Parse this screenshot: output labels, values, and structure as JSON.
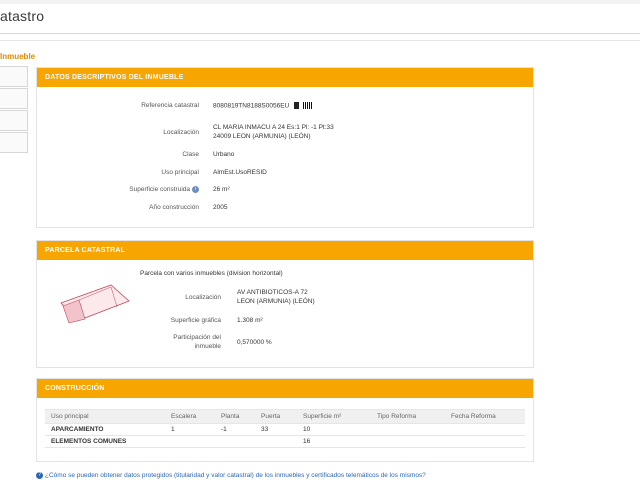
{
  "header": {
    "title": "atastro"
  },
  "section_label": "Inmueble",
  "datos": {
    "heading": "DATOS DESCRIPTIVOS DEL INMUEBLE",
    "ref_label": "Referencia catastral",
    "ref_value": "8080819TN8188S0056EU",
    "loc_label": "Localización",
    "loc_line1": "CL MARIA INMACU A 24 Es:1 Pl: -1 Pt:33",
    "loc_line2": "24009 LEON (ARMUNIA) (LEÓN)",
    "clase_label": "Clase",
    "clase_value": "Urbano",
    "uso_label": "Uso principal",
    "uso_value": "AlmEst.UsoRESID",
    "sup_label": "Superficie construida",
    "sup_value": "26 m²",
    "anio_label": "Año construcción",
    "anio_value": "2005"
  },
  "parcela": {
    "heading": "PARCELA CATASTRAL",
    "desc": "Parcela con varios inmuebles (division horizontal)",
    "loc_label": "Localización",
    "loc_line1": "AV ANTIBIOTICOS-A 72",
    "loc_line2": "LEON (ARMUNIA) (LEÓN)",
    "sup_label": "Superficie gráfica",
    "sup_value": "1.308 m²",
    "part_label_1": "Participación del",
    "part_label_2": "inmueble",
    "part_value": "0,570000 %"
  },
  "construccion": {
    "heading": "CONSTRUCCIÓN",
    "columns": [
      "Uso principal",
      "Escalera",
      "Planta",
      "Puerta",
      "Superficie m²",
      "Tipo Reforma",
      "Fecha Reforma"
    ],
    "rows": [
      [
        "APARCAMIENTO",
        "1",
        "-1",
        "33",
        "10",
        "",
        ""
      ],
      [
        "ELEMENTOS COMUNES",
        "",
        "",
        "",
        "16",
        "",
        ""
      ]
    ]
  },
  "footer_link": "¿Cómo se pueden obtener datos protegidos (titularidad y valor catastral) de los inmuebles y certificados telemáticos de los mismos?",
  "colors": {
    "accent": "#f7a500",
    "label_orange": "#e08a00",
    "link": "#2b67b5"
  }
}
